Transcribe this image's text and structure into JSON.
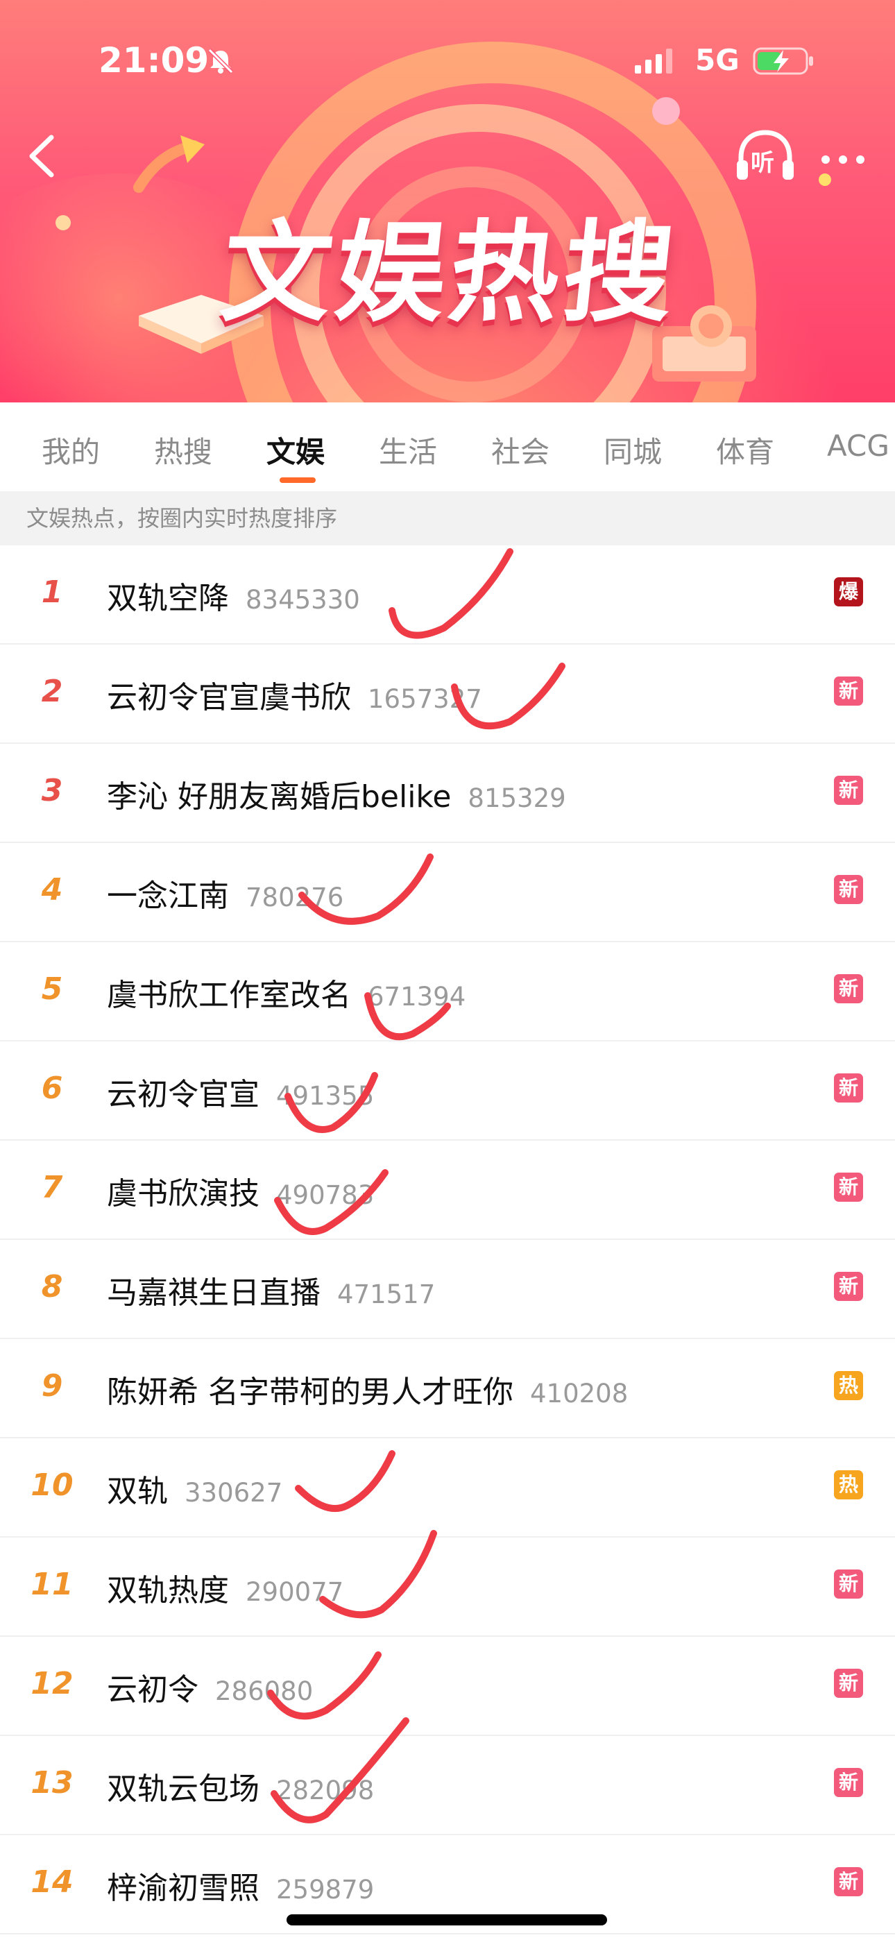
{
  "status_bar": {
    "time": "21:09",
    "network": "5G",
    "icons": [
      "bell-muted-icon",
      "signal-icon",
      "battery-charging-icon"
    ]
  },
  "header": {
    "banner_title": "文娱热搜",
    "back_icon": "chevron-left-icon",
    "listen_label": "听",
    "more_icon": "more-dots-icon"
  },
  "tabs": [
    {
      "label": "我的",
      "active": false
    },
    {
      "label": "热搜",
      "active": false
    },
    {
      "label": "文娱",
      "active": true
    },
    {
      "label": "生活",
      "active": false
    },
    {
      "label": "社会",
      "active": false
    },
    {
      "label": "同城",
      "active": false
    },
    {
      "label": "体育",
      "active": false
    },
    {
      "label": "ACG",
      "active": false
    }
  ],
  "subheader": "文娱热点，按圈内实时热度排序",
  "items": [
    {
      "rank": "1",
      "title": "双轨空降",
      "count": "8345330",
      "badge": "爆"
    },
    {
      "rank": "2",
      "title": "云初令官宣虞书欣",
      "count": "1657327",
      "badge": "新"
    },
    {
      "rank": "3",
      "title": "李沁 好朋友离婚后belike",
      "count": "815329",
      "badge": "新"
    },
    {
      "rank": "4",
      "title": "一念江南",
      "count": "780276",
      "badge": "新"
    },
    {
      "rank": "5",
      "title": "虞书欣工作室改名",
      "count": "671394",
      "badge": "新"
    },
    {
      "rank": "6",
      "title": "云初令官宣",
      "count": "491355",
      "badge": "新"
    },
    {
      "rank": "7",
      "title": "虞书欣演技",
      "count": "490783",
      "badge": "新"
    },
    {
      "rank": "8",
      "title": "马嘉祺生日直播",
      "count": "471517",
      "badge": "新"
    },
    {
      "rank": "9",
      "title": "陈妍希 名字带柯的男人才旺你",
      "count": "410208",
      "badge": "热"
    },
    {
      "rank": "10",
      "title": "双轨",
      "count": "330627",
      "badge": "热"
    },
    {
      "rank": "11",
      "title": "双轨热度",
      "count": "290077",
      "badge": "新"
    },
    {
      "rank": "12",
      "title": "云初令",
      "count": "286080",
      "badge": "新"
    },
    {
      "rank": "13",
      "title": "双轨云包场",
      "count": "282098",
      "badge": "新"
    },
    {
      "rank": "14",
      "title": "梓渝初雪照",
      "count": "259879",
      "badge": "新"
    }
  ],
  "colors": {
    "rank_top3": "#e8514a",
    "rank_other": "#f0932b",
    "badge_bao": "#b4141c",
    "badge_xin": "#f3597a",
    "badge_re": "#f7a51e",
    "tab_accent": "#ff6a2b",
    "check_mark": "#ee3b45"
  }
}
